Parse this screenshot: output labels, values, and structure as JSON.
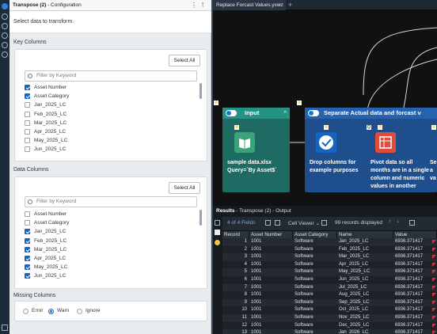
{
  "config": {
    "title": "Transpose (2)",
    "title_suffix": "- Configuration",
    "instruction": "Select data to transform.",
    "key_columns": {
      "title": "Key Columns",
      "select_all": "Select All",
      "filter_placeholder": "Filter by Keyword",
      "items": [
        {
          "label": "Asset Number",
          "checked": true
        },
        {
          "label": "Asset Category",
          "checked": true
        },
        {
          "label": "Jan_2025_LC",
          "checked": false
        },
        {
          "label": "Feb_2025_LC",
          "checked": false
        },
        {
          "label": "Mar_2025_LC",
          "checked": false
        },
        {
          "label": "Apr_2025_LC",
          "checked": false
        },
        {
          "label": "May_2025_LC",
          "checked": false
        },
        {
          "label": "Jun_2025_LC",
          "checked": false
        }
      ]
    },
    "data_columns": {
      "title": "Data Columns",
      "select_all": "Select All",
      "filter_placeholder": "Filter by Keyword",
      "items": [
        {
          "label": "Asset Number",
          "checked": false
        },
        {
          "label": "Asset Category",
          "checked": false
        },
        {
          "label": "Jan_2025_LC",
          "checked": true
        },
        {
          "label": "Feb_2025_LC",
          "checked": true
        },
        {
          "label": "Mar_2025_LC",
          "checked": true
        },
        {
          "label": "Apr_2025_LC",
          "checked": true
        },
        {
          "label": "May_2025_LC",
          "checked": true
        },
        {
          "label": "Jun_2025_LC",
          "checked": true
        }
      ]
    },
    "missing_columns": {
      "title": "Missing Columns",
      "options": [
        {
          "label": "Error",
          "selected": false
        },
        {
          "label": "Warn",
          "selected": true
        },
        {
          "label": "Ignore",
          "selected": false
        }
      ]
    }
  },
  "canvas": {
    "tab_label": "Replace Forcast Values.yxwz",
    "input_container": {
      "title": "Input",
      "tool_label": "sample data.xlsx Query=`By Asset$`"
    },
    "separate_container": {
      "title": "Separate Actual data and forcast v"
    },
    "select_label": "Drop columns for example purposes",
    "transpose_label": "Pivot data so all months are in a single column and numeric values in another",
    "partial_label": "Se a va"
  },
  "results": {
    "title": "Results",
    "subtitle": "- Transpose (2) - Output",
    "fields_label": "4 of 4 Fields",
    "viewer": "Cell Viewer",
    "records": "99 records displayed",
    "columns": [
      "Record",
      "Asset Number",
      "Asset Category",
      "Name",
      "Value"
    ],
    "rows": [
      [
        "1",
        "1001",
        "Software",
        "Jan_2025_LC",
        "6936.371417"
      ],
      [
        "2",
        "1001",
        "Software",
        "Feb_2025_LC",
        "6936.371417"
      ],
      [
        "3",
        "1001",
        "Software",
        "Mar_2025_LC",
        "6936.371417"
      ],
      [
        "4",
        "1001",
        "Software",
        "Apr_2025_LC",
        "6936.371417"
      ],
      [
        "5",
        "1001",
        "Software",
        "May_2025_LC",
        "6936.371417"
      ],
      [
        "6",
        "1001",
        "Software",
        "Jun_2025_LC",
        "6936.371417"
      ],
      [
        "7",
        "1001",
        "Software",
        "Jul_2025_LC",
        "6936.371417"
      ],
      [
        "8",
        "1001",
        "Software",
        "Aug_2025_LC",
        "6936.371417"
      ],
      [
        "9",
        "1001",
        "Software",
        "Sep_2025_LC",
        "6936.371417"
      ],
      [
        "10",
        "1001",
        "Software",
        "Oct_2025_LC",
        "6936.371417"
      ],
      [
        "11",
        "1001",
        "Software",
        "Nov_2025_LC",
        "6936.371417"
      ],
      [
        "12",
        "1001",
        "Software",
        "Dec_2025_LC",
        "6936.371417"
      ],
      [
        "13",
        "1001",
        "Software",
        "Jan_2026_LC",
        "6936.371417"
      ]
    ]
  },
  "colors": {
    "accent": "#1565c0",
    "container_blue": "#1f4e8c",
    "input_teal": "#1d6b62"
  }
}
